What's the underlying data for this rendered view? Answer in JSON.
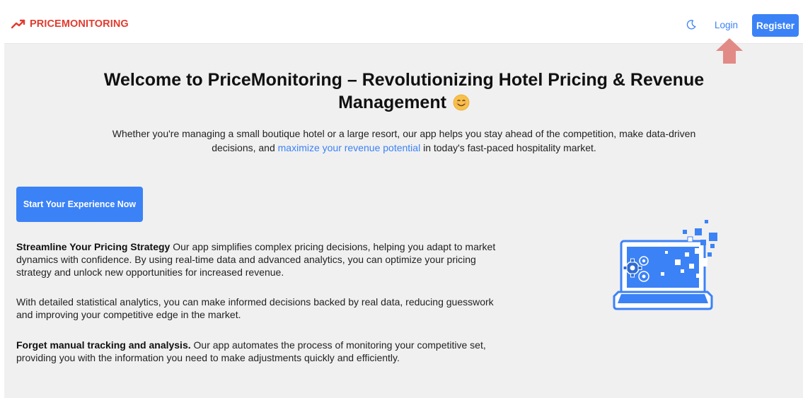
{
  "nav": {
    "brand": "PRICEMONITORING",
    "login_label": "Login",
    "register_label": "Register",
    "brand_color": "#e23b2e",
    "accent_color": "#3b82f6",
    "theme_icon": "moon-icon"
  },
  "hero": {
    "title": "Welcome to PriceMonitoring – Revolutionizing Hotel Pricing & Revenue Management",
    "emoji": "smiling-face-emoji",
    "subtitle_pre": "Whether you're managing a small boutique hotel or a large resort, our app helps you stay ahead of the competition, make data-driven decisions, and ",
    "subtitle_link": "maximize your revenue potential",
    "subtitle_post": " in today's fast-paced hospitality market.",
    "cta_label": "Start Your Experience Now"
  },
  "features": [
    {
      "lead": "Streamline Your Pricing Strategy",
      "text": " Our app simplifies complex pricing decisions, helping you adapt to market dynamics with confidence. By using real-time data and advanced analytics, you can optimize your pricing strategy and unlock new opportunities for increased revenue."
    },
    {
      "lead": "",
      "text": "With detailed statistical analytics, you can make informed decisions backed by real data, reducing guesswork and improving your competitive edge in the market."
    },
    {
      "lead": "Forget manual tracking and analysis.",
      "text": " Our app automates the process of monitoring your competitive set, providing you with the information you need to make adjustments quickly and efficiently."
    }
  ],
  "illustration": "laptop-analytics-illustration"
}
